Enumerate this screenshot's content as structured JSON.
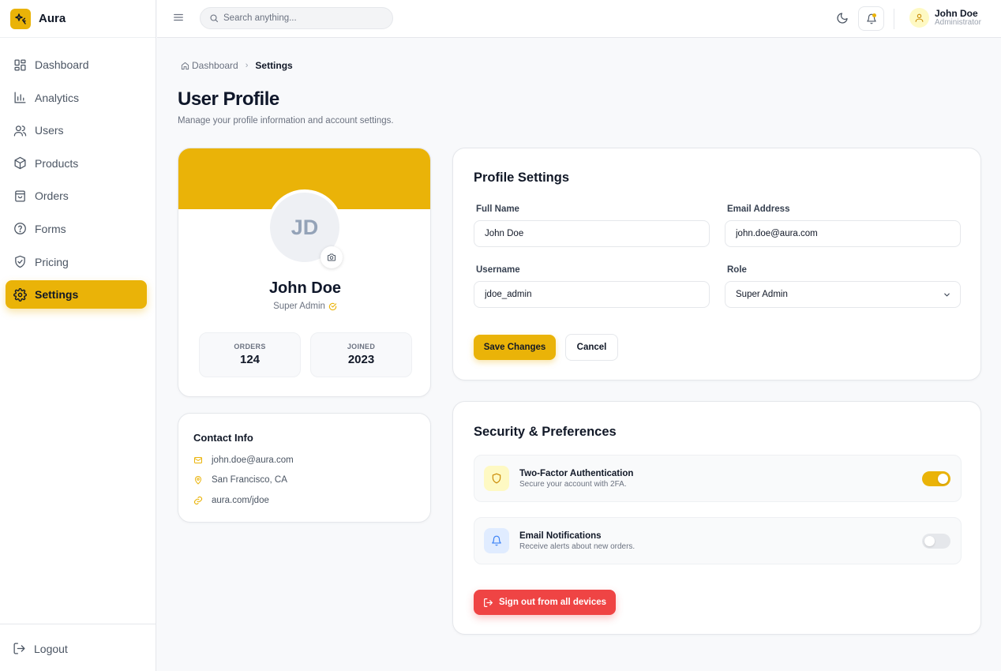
{
  "colors": {
    "accent": "#eab308",
    "danger": "#ef4444",
    "toggle_off": "#e5e7eb",
    "info_bg": "#e0ecff",
    "info_fg": "#3b82f6"
  },
  "app": {
    "name": "Aura"
  },
  "sidebar": {
    "items": [
      {
        "label": "Dashboard",
        "icon": "dashboard-grid-icon",
        "active": false
      },
      {
        "label": "Analytics",
        "icon": "bar-chart-icon",
        "active": false
      },
      {
        "label": "Users",
        "icon": "users-icon",
        "active": false
      },
      {
        "label": "Products",
        "icon": "box-icon",
        "active": false
      },
      {
        "label": "Orders",
        "icon": "shopping-bag-icon",
        "active": false
      },
      {
        "label": "Forms",
        "icon": "help-circle-icon",
        "active": false
      },
      {
        "label": "Pricing",
        "icon": "shield-check-icon",
        "active": false
      },
      {
        "label": "Settings",
        "icon": "gear-icon",
        "active": true
      }
    ],
    "logout_label": "Logout"
  },
  "header": {
    "search_placeholder": "Search anything...",
    "user": {
      "name": "John Doe",
      "role": "Administrator"
    }
  },
  "breadcrumb": {
    "home": "Dashboard",
    "current": "Settings"
  },
  "page": {
    "title": "User Profile",
    "subtitle": "Manage your profile information and account settings."
  },
  "profile": {
    "initials": "JD",
    "name": "John Doe",
    "role": "Super Admin",
    "stats": [
      {
        "label": "ORDERS",
        "value": "124"
      },
      {
        "label": "JOINED",
        "value": "2023"
      }
    ]
  },
  "contact": {
    "title": "Contact Info",
    "email": "john.doe@aura.com",
    "location": "San Francisco, CA",
    "website": "aura.com/jdoe"
  },
  "profile_settings": {
    "title": "Profile Settings",
    "full_name_label": "Full Name",
    "full_name_value": "John Doe",
    "email_label": "Email Address",
    "email_value": "john.doe@aura.com",
    "username_label": "Username",
    "username_value": "jdoe_admin",
    "role_label": "Role",
    "role_value": "Super Admin",
    "save_label": "Save Changes",
    "cancel_label": "Cancel"
  },
  "security": {
    "title": "Security & Preferences",
    "two_factor": {
      "title": "Two-Factor Authentication",
      "desc": "Secure your account with 2FA.",
      "enabled": true
    },
    "email_notifications": {
      "title": "Email Notifications",
      "desc": "Receive alerts about new orders.",
      "enabled": false
    },
    "signout_label": "Sign out from all devices"
  }
}
